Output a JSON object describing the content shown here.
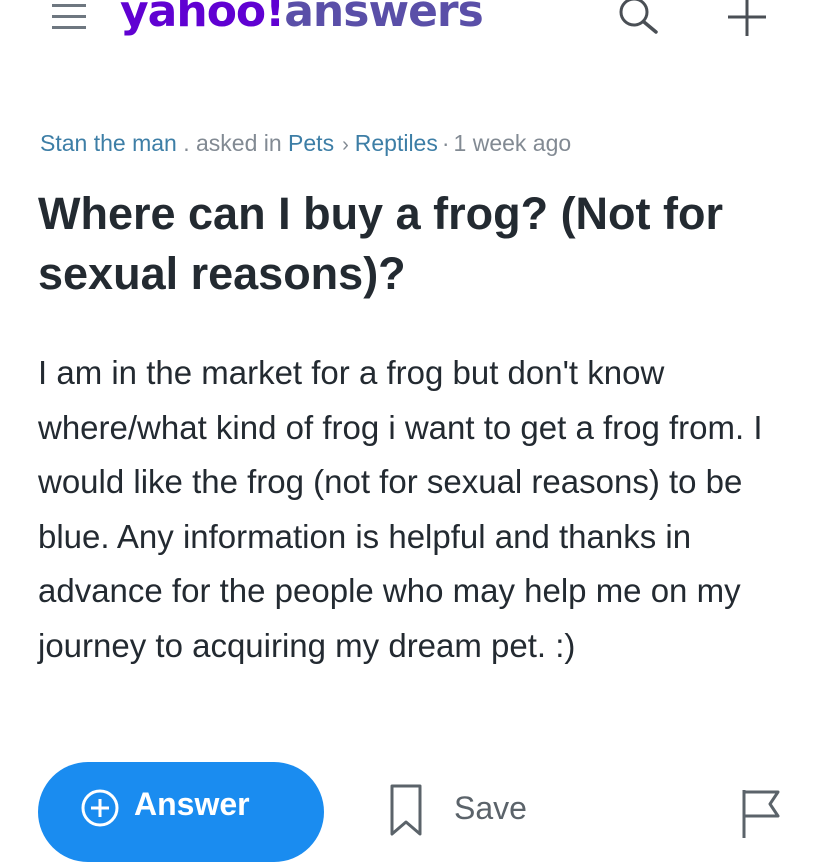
{
  "header": {
    "logo_brand": "yahoo!",
    "logo_product": "answers",
    "icons": [
      "menu-icon",
      "search-icon",
      "plus-icon"
    ]
  },
  "question": {
    "author": "Stan the man",
    "asked_in": ". asked in",
    "category": "Pets",
    "subcategory": "Reptiles",
    "separator": "·",
    "time": "1 week ago",
    "title": "Where can I buy a frog? (Not for sexual reasons)?",
    "body": "I am in the market for a frog but don't know where/what kind of frog i want to get a frog from. I would like the frog (not for sexual reasons) to be blue. Any information is helpful and thanks in advance for the people who may help me on my journey to acquiring my dream pet. :)"
  },
  "actions": {
    "answer_label": "Answer",
    "save_label": "Save",
    "icons": [
      "plus-circle-icon",
      "bookmark-icon",
      "flag-icon"
    ]
  },
  "colors": {
    "brand": "#6001d2",
    "link": "#3d7ea6",
    "muted": "#828a93",
    "answer_button": "#1a8cf0"
  }
}
